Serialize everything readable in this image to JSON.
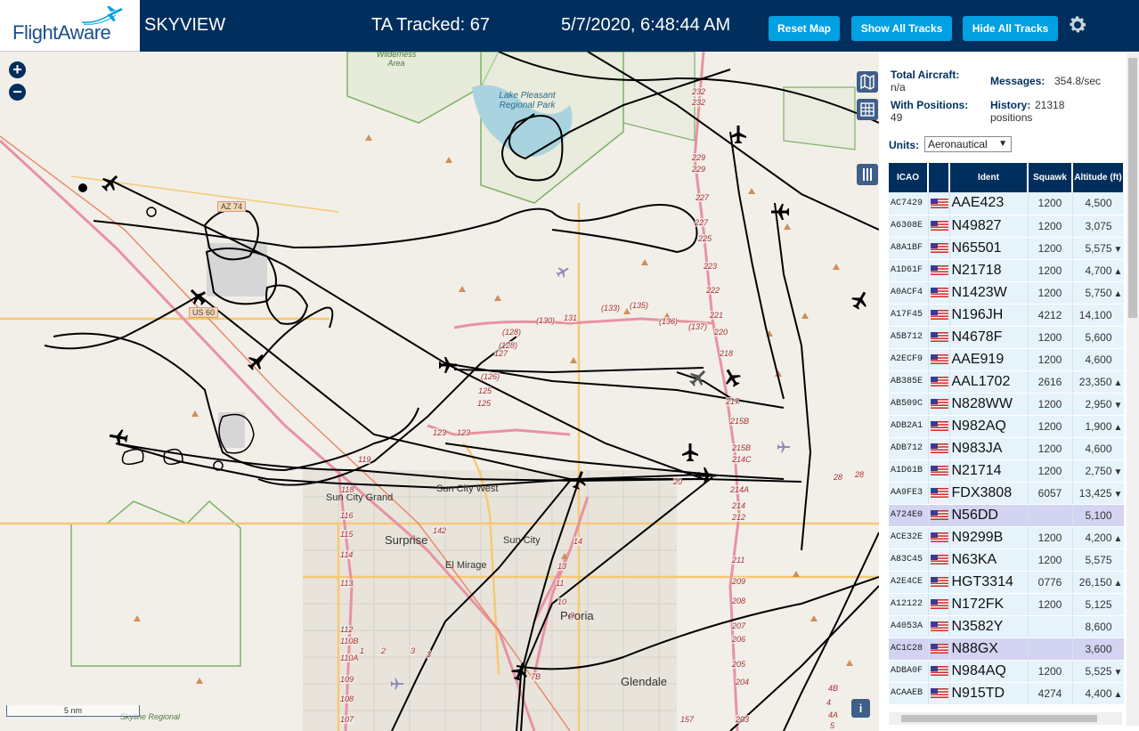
{
  "header": {
    "logo_text": "FlightAware",
    "app_name": "SKYVIEW",
    "ta_tracked": "TA Tracked: 67",
    "datetime": "5/7/2020, 6:48:44 AM",
    "buttons": {
      "reset_map": "Reset Map",
      "show_all": "Show All Tracks",
      "hide_all": "Hide All Tracks"
    },
    "settings_icon": "gear-icon"
  },
  "map": {
    "zoom_in": "+",
    "zoom_out": "−",
    "scale": "5 nm",
    "info": "i",
    "labels": {
      "wilderness": "Wilderness Area",
      "lake": "Lake Pleasant Regional Park",
      "az74": "AZ 74",
      "us60": "US 60",
      "sun_city_grand": "Sun City Grand",
      "sun_city_west": "Sun City West",
      "surprise": "Surprise",
      "sun_city": "Sun City",
      "el_mirage": "El Mirage",
      "peoria": "Peoria",
      "glendale": "Glendale",
      "skyline": "Skyline Regional"
    },
    "route_markers": [
      "232",
      "232",
      "229",
      "229",
      "227",
      "227",
      "225",
      "223",
      "222",
      "221",
      "220",
      "218",
      "217",
      "215B",
      "215B",
      "214C",
      "214A",
      "214",
      "212",
      "211",
      "209",
      "208",
      "207",
      "206",
      "205",
      "204",
      "203",
      "(128)",
      "(128)",
      "127",
      "(126)",
      "125",
      "125",
      "123",
      "123",
      "(130)",
      "131",
      "(133)",
      "(135)",
      "(136)",
      "(137)",
      "119",
      "118",
      "116",
      "115",
      "114",
      "113",
      "112",
      "110B",
      "110A",
      "109",
      "108",
      "107",
      "1",
      "2",
      "3",
      "3",
      "142",
      "14",
      "13",
      "11",
      "10",
      "9",
      "7B",
      "4",
      "4A",
      "4B",
      "5",
      "157",
      "28",
      "28",
      "20"
    ],
    "colors": {
      "land": "#f2efe9",
      "track": "#000000",
      "highway": "#e892a2",
      "road": "#f7c873",
      "park": "#c8dfb6",
      "water": "#a9d3df",
      "boundary": "#7db267"
    }
  },
  "panel": {
    "total_aircraft_label": "Total Aircraft:",
    "total_aircraft_value": "n/a",
    "with_positions_label": "With Positions:",
    "with_positions_value": "49",
    "messages_label": "Messages:",
    "messages_value": "354.8/sec",
    "history_label": "History:",
    "history_value": "21318 positions",
    "units_label": "Units:",
    "units_value": "Aeronautical",
    "columns": [
      "ICAO",
      "",
      "Ident",
      "Squawk",
      "Altitude (ft)"
    ],
    "rows": [
      {
        "icao": "AC7429",
        "ident": "AAE423",
        "squawk": "1200",
        "alt": "4,500",
        "trend": "",
        "hl": false
      },
      {
        "icao": "A6308E",
        "ident": "N49827",
        "squawk": "1200",
        "alt": "3,075",
        "trend": "",
        "hl": false
      },
      {
        "icao": "A8A1BF",
        "ident": "N65501",
        "squawk": "1200",
        "alt": "5,575",
        "trend": "▼",
        "hl": false
      },
      {
        "icao": "A1D61F",
        "ident": "N21718",
        "squawk": "1200",
        "alt": "4,700",
        "trend": "▲",
        "hl": false
      },
      {
        "icao": "A0ACF4",
        "ident": "N1423W",
        "squawk": "1200",
        "alt": "5,750",
        "trend": "▲",
        "hl": false
      },
      {
        "icao": "A17F45",
        "ident": "N196JH",
        "squawk": "4212",
        "alt": "14,100",
        "trend": "",
        "hl": false
      },
      {
        "icao": "A5B712",
        "ident": "N4678F",
        "squawk": "1200",
        "alt": "5,600",
        "trend": "",
        "hl": false
      },
      {
        "icao": "A2ECF9",
        "ident": "AAE919",
        "squawk": "1200",
        "alt": "4,600",
        "trend": "",
        "hl": false
      },
      {
        "icao": "AB385E",
        "ident": "AAL1702",
        "squawk": "2616",
        "alt": "23,350",
        "trend": "▲",
        "hl": false
      },
      {
        "icao": "AB509C",
        "ident": "N828WW",
        "squawk": "1200",
        "alt": "2,950",
        "trend": "▼",
        "hl": false
      },
      {
        "icao": "ADB2A1",
        "ident": "N982AQ",
        "squawk": "1200",
        "alt": "1,900",
        "trend": "▲",
        "hl": false
      },
      {
        "icao": "ADB712",
        "ident": "N983JA",
        "squawk": "1200",
        "alt": "4,600",
        "trend": "",
        "hl": false
      },
      {
        "icao": "A1D61B",
        "ident": "N21714",
        "squawk": "1200",
        "alt": "2,750",
        "trend": "▼",
        "hl": false
      },
      {
        "icao": "AA9FE3",
        "ident": "FDX3808",
        "squawk": "6057",
        "alt": "13,425",
        "trend": "▼",
        "hl": false
      },
      {
        "icao": "A724E0",
        "ident": "N56DD",
        "squawk": "",
        "alt": "5,100",
        "trend": "",
        "hl": true
      },
      {
        "icao": "ACE32E",
        "ident": "N9299B",
        "squawk": "1200",
        "alt": "4,200",
        "trend": "▲",
        "hl": false
      },
      {
        "icao": "A83C45",
        "ident": "N63KA",
        "squawk": "1200",
        "alt": "5,575",
        "trend": "",
        "hl": false
      },
      {
        "icao": "A2E4CE",
        "ident": "HGT3314",
        "squawk": "0776",
        "alt": "26,150",
        "trend": "▲",
        "hl": false
      },
      {
        "icao": "A12122",
        "ident": "N172FK",
        "squawk": "1200",
        "alt": "5,125",
        "trend": "",
        "hl": false
      },
      {
        "icao": "A4053A",
        "ident": "N3582Y",
        "squawk": "",
        "alt": "8,600",
        "trend": "",
        "hl": false
      },
      {
        "icao": "AC1C28",
        "ident": "N88GX",
        "squawk": "",
        "alt": "3,600",
        "trend": "",
        "hl": true
      },
      {
        "icao": "ADBA0F",
        "ident": "N984AQ",
        "squawk": "1200",
        "alt": "5,525",
        "trend": "▼",
        "hl": false
      },
      {
        "icao": "ACAAEB",
        "ident": "N915TD",
        "squawk": "4274",
        "alt": "4,400",
        "trend": "▲",
        "hl": false
      }
    ]
  }
}
